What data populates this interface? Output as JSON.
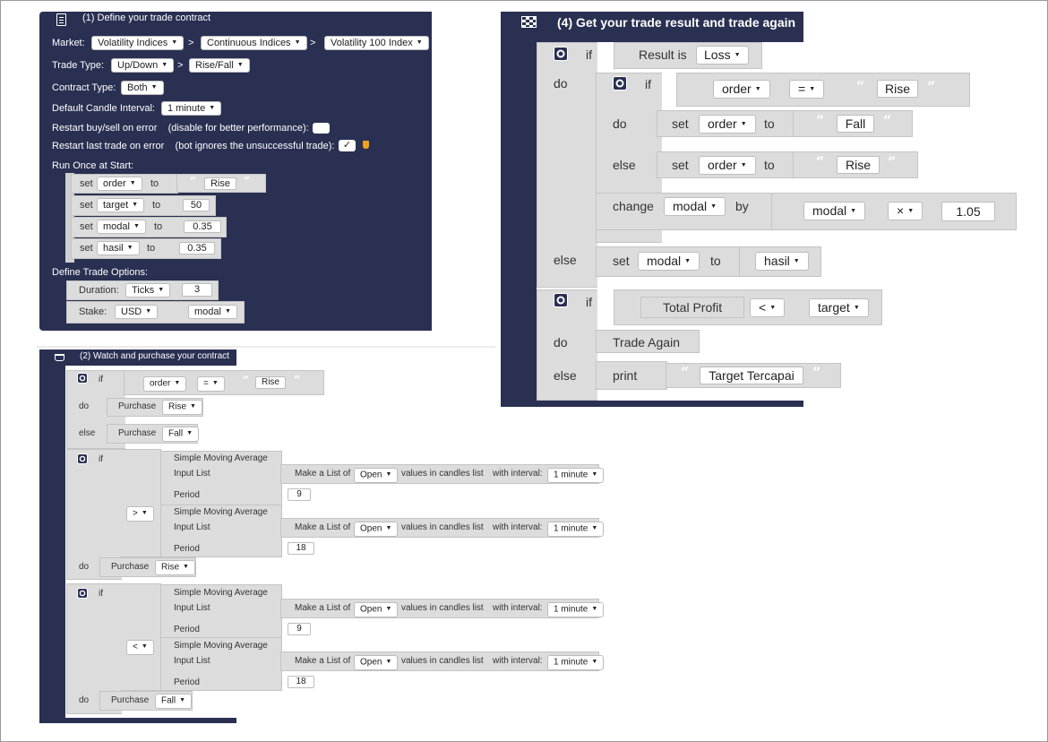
{
  "s1": {
    "title": "(1) Define your trade contract",
    "market_label": "Market:",
    "market": [
      "Volatility Indices",
      "Continuous Indices",
      "Volatility 100 Index"
    ],
    "trade_type_label": "Trade Type:",
    "trade_type": [
      "Up/Down",
      "Rise/Fall"
    ],
    "contract_type_label": "Contract Type:",
    "contract_type": "Both",
    "candle_label": "Default Candle Interval:",
    "candle": "1 minute",
    "restart_buysell": "Restart buy/sell on error    (disable for better performance):",
    "restart_last": "Restart last trade on error    (bot ignores the unsuccessful trade):",
    "check": "✓",
    "run_once": "Run Once at Start:",
    "sets": [
      {
        "kw": "set",
        "var": "order",
        "to": "to",
        "val": "Rise"
      },
      {
        "kw": "set",
        "var": "target",
        "to": "to",
        "val": "50"
      },
      {
        "kw": "set",
        "var": "modal",
        "to": "to",
        "val": "0.35"
      },
      {
        "kw": "set",
        "var": "hasil",
        "to": "to",
        "val": "0.35"
      }
    ],
    "define_opts": "Define Trade Options:",
    "duration_label": "Duration:",
    "duration_unit": "Ticks",
    "duration_val": "3",
    "stake_label": "Stake:",
    "stake_cur": "USD",
    "stake_var": "modal"
  },
  "s2": {
    "title": "(2) Watch and purchase your contract",
    "if": "if",
    "do": "do",
    "else": "else",
    "order": "order",
    "eq": "=",
    "rise": "Rise",
    "fall": "Fall",
    "purchase": "Purchase",
    "sma": "Simple Moving Average",
    "input_list": "Input List",
    "period": "Period",
    "make_list": "Make a List of",
    "open": "Open",
    "values_in": "values in candles list",
    "with_interval": "with interval:",
    "interval": "1 minute",
    "gt": ">",
    "lt": "<",
    "p9": "9",
    "p18": "18"
  },
  "s4": {
    "title": "(4) Get your trade result and trade again",
    "if": "if",
    "do": "do",
    "else": "else",
    "result_is": "Result is",
    "loss": "Loss",
    "order": "order",
    "eq": "=",
    "rise": "Rise",
    "fall": "Fall",
    "set": "set",
    "to": "to",
    "change": "change",
    "modal": "modal",
    "by": "by",
    "times": "×",
    "factor": "1.05",
    "hasil": "hasil",
    "total_profit": "Total Profit",
    "lt": "<",
    "target": "target",
    "trade_again": "Trade Again",
    "print": "print",
    "tercapai": "Target Tercapai"
  }
}
